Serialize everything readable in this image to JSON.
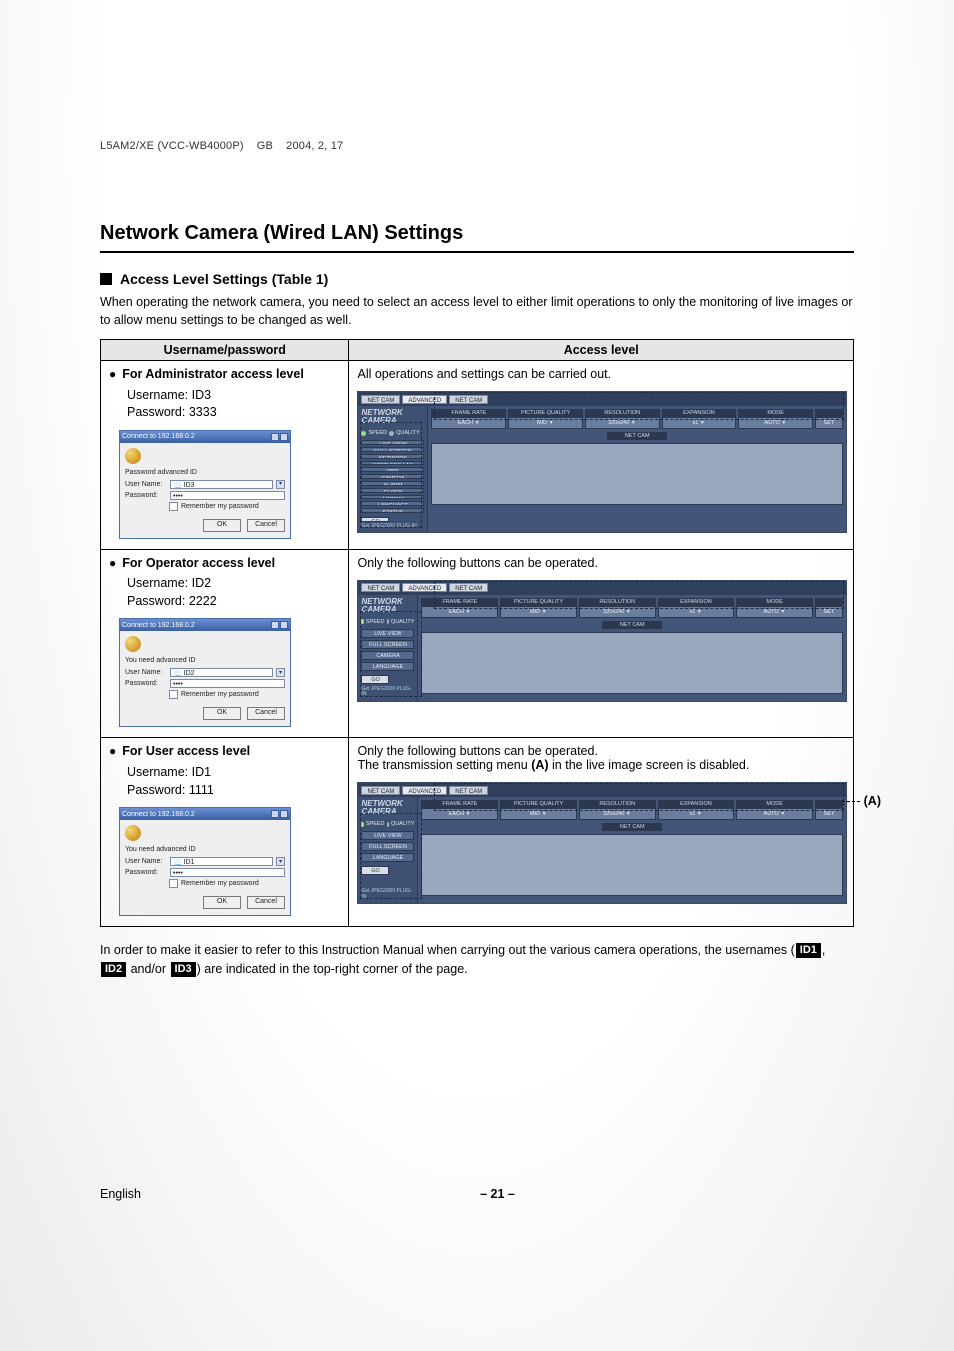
{
  "doc_code": "L5AM2/XE (VCC-WB4000P)    GB    2004, 2, 17",
  "page_title": "Network Camera (Wired LAN) Settings",
  "section_title": "Access Level Settings (Table 1)",
  "intro": "When operating the network camera, you need to select an access level to either limit operations to only the monitoring of live images or to allow menu settings to be changed as well.",
  "table": {
    "headers": [
      "Username/password",
      "Access level"
    ],
    "rows": [
      {
        "title": "For Administrator access level",
        "username_label": "Username:",
        "username": "ID3",
        "password_label": "Password:",
        "password": "3333",
        "login": {
          "title": "Connect to 192.168.0.2",
          "prompt": "Password advanced ID",
          "user_label": "User Name:",
          "user_value": "ID3",
          "pass_label": "Password:",
          "remember": "Remember my password",
          "ok": "OK",
          "cancel": "Cancel"
        },
        "right_desc": "All operations and settings can be carried out.",
        "menu": [
          "LIVE VIEW",
          "FULL SCREEN",
          "NETWORK",
          "WIRELESS LAN",
          "DNS",
          "CAMERA",
          "ALARM",
          "CLOCK",
          "ACCESS",
          "LANGUAGE",
          "STATUS"
        ]
      },
      {
        "title": "For Operator access level",
        "username_label": "Username:",
        "username": "ID2",
        "password_label": "Password:",
        "password": "2222",
        "login": {
          "title": "Connect to 192.168.0.2",
          "prompt": "You need advanced ID",
          "user_label": "User Name:",
          "user_value": "ID2",
          "pass_label": "Password:",
          "remember": "Remember my password",
          "ok": "OK",
          "cancel": "Cancel"
        },
        "right_desc": "Only the following buttons can be operated.",
        "menu": [
          "LIVE VIEW",
          "FULL SCREEN",
          "CAMERA",
          "LANGUAGE"
        ]
      },
      {
        "title": "For User access level",
        "username_label": "Username:",
        "username": "ID1",
        "password_label": "Password:",
        "password": "1111",
        "login": {
          "title": "Connect to 192.168.0.2",
          "prompt": "You need advanced ID",
          "user_label": "User Name:",
          "user_value": "ID1",
          "pass_label": "Password:",
          "remember": "Remember my password",
          "ok": "OK",
          "cancel": "Cancel"
        },
        "right_desc": "Only the following buttons can be operated.",
        "right_extra_a": "The transmission setting menu ",
        "right_extra_b": "(A)",
        "right_extra_c": " in the live image screen is disabled.",
        "menu": [
          "LIVE VIEW",
          "FULL SCREEN",
          "LANGUAGE"
        ]
      }
    ]
  },
  "camui": {
    "brand_l1": "NETWORK",
    "brand_l2": "CAMERA",
    "tabs": [
      "NET CAM",
      "ADVANCED",
      "NET CAM"
    ],
    "params": [
      {
        "label": "FRAME RATE",
        "value": "EACH"
      },
      {
        "label": "PICTURE QUALITY",
        "value": "MID"
      },
      {
        "label": "RESOLUTION",
        "value": "320x240"
      },
      {
        "label": "EXPANSION",
        "value": "x1"
      },
      {
        "label": "MODE",
        "value": "AUTO"
      }
    ],
    "set_btn": "SET",
    "chip": "NET CAM",
    "speed_label": "SPEED",
    "quality_label": "QUALITY",
    "go": "GO",
    "plugin": "Get JPEG2000 PLUG-IN"
  },
  "annotation_a": "(A)",
  "foot_note_a": "In order to make it easier to refer to this Instruction Manual when carrying out the various camera operations, the usernames (",
  "foot_note_b": ", ",
  "foot_note_c": " and/or ",
  "foot_note_d": ") are indicated in the top-right corner of the page.",
  "badges": {
    "id1": "ID1",
    "id2": "ID2",
    "id3": "ID3"
  },
  "footer": {
    "left": "English",
    "center": "– 21 –"
  }
}
